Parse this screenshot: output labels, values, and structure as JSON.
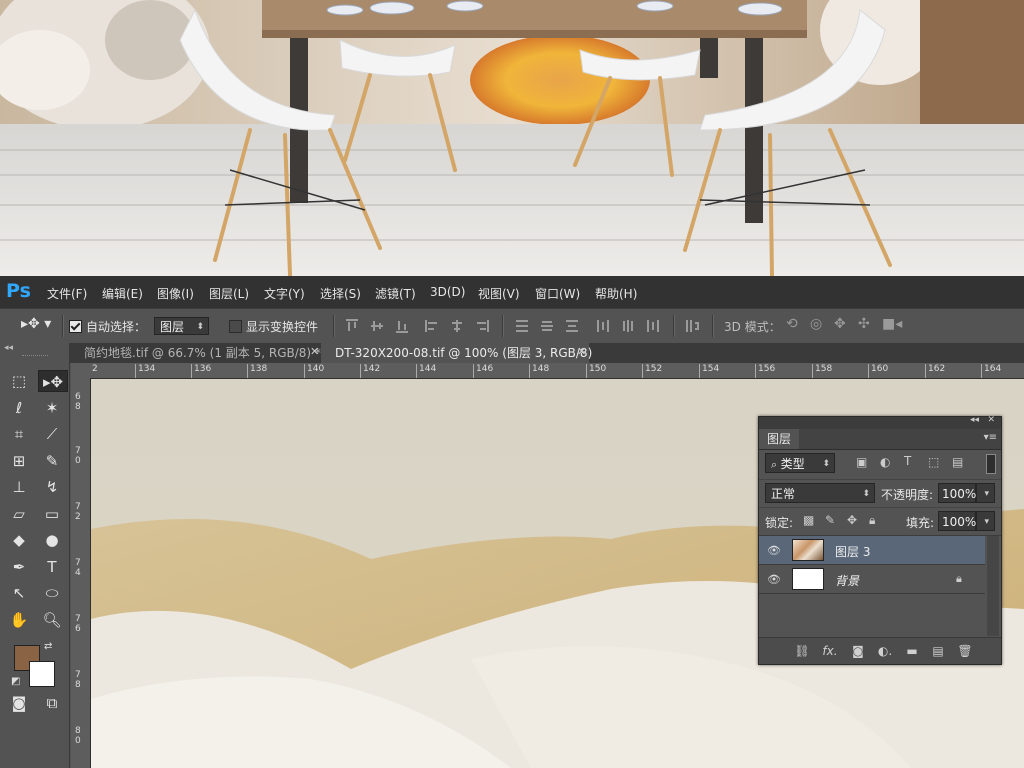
{
  "app": {
    "logo": "Ps",
    "menu": [
      "文件(F)",
      "编辑(E)",
      "图像(I)",
      "图层(L)",
      "文字(Y)",
      "选择(S)",
      "滤镜(T)",
      "3D(D)",
      "视图(V)",
      "窗口(W)",
      "帮助(H)"
    ]
  },
  "options": {
    "auto_select_label": "自动选择：",
    "auto_select_checked": true,
    "auto_select_target": "图层",
    "show_transform_label": "显示变换控件",
    "show_transform_checked": false,
    "mode_3d_label": "3D 模式："
  },
  "tabs": [
    {
      "title": "简约地毯.tif @ 66.7% (1 副本 5, RGB/8) *",
      "active": false
    },
    {
      "title": "DT-320X200-08.tif @ 100% (图层 3, RGB/8)",
      "active": true
    }
  ],
  "ruler": {
    "h": [
      "2",
      "134",
      "136",
      "138",
      "140",
      "142",
      "144",
      "146",
      "148",
      "150",
      "152",
      "154",
      "156",
      "158",
      "160",
      "162",
      "164"
    ],
    "v": [
      "68",
      "70",
      "72",
      "74",
      "76",
      "78",
      "80"
    ]
  },
  "colors": {
    "foreground": "#8a6345",
    "background": "#ffffff",
    "accent": "#31a8ff"
  },
  "layers_panel": {
    "title": "图层",
    "filter_kind": "类型",
    "blend_mode": "正常",
    "opacity_label": "不透明度:",
    "opacity_value": "100%",
    "lock_label": "锁定:",
    "fill_label": "填充:",
    "fill_value": "100%",
    "layers": [
      {
        "name": "图层 3",
        "selected": true,
        "visible": true,
        "thumbnail": "floral-photo"
      },
      {
        "name": "背景",
        "selected": false,
        "visible": true,
        "thumbnail": "white",
        "locked": true
      }
    ],
    "footer_icons": [
      "link-icon",
      "fx-icon",
      "mask-icon",
      "adjustment-icon",
      "folder-icon",
      "new-layer-icon",
      "trash-icon"
    ]
  }
}
